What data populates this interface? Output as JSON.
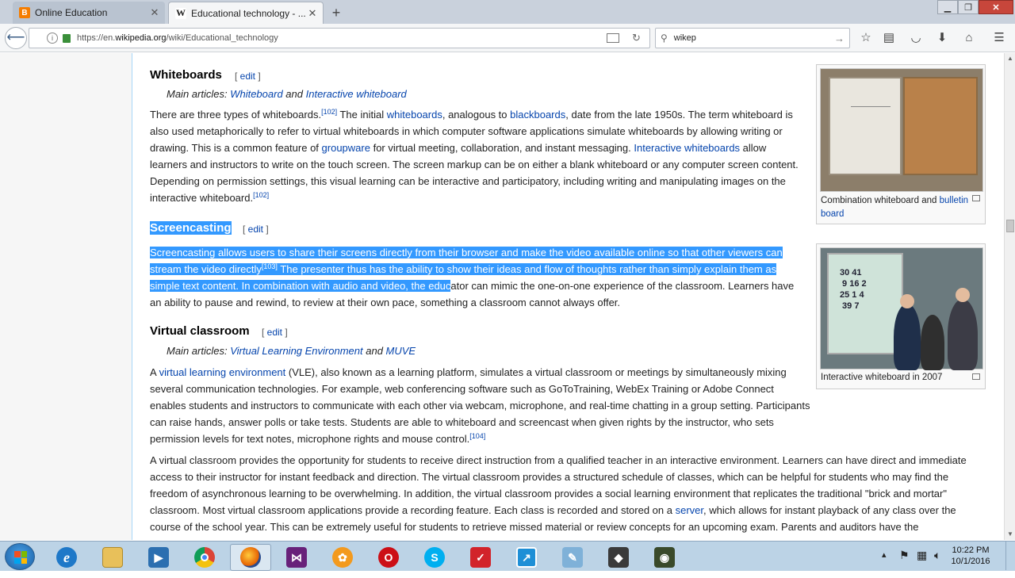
{
  "browser": {
    "tabs": [
      {
        "title": "Online Education",
        "active": false
      },
      {
        "title": "Educational technology - ...",
        "active": true
      }
    ],
    "new_tab": "+",
    "url_prefix": "https://en.",
    "url_domain": "wikipedia.org",
    "url_path": "/wiki/Educational_technology",
    "search_value": "wikep"
  },
  "article": {
    "whiteboards": {
      "heading": "Whiteboards",
      "edit": "edit",
      "main_prefix": "Main articles: ",
      "main_link1": "Whiteboard",
      "main_and": " and ",
      "main_link2": "Interactive whiteboard",
      "p1": [
        "There are three types of whiteboards.",
        "[102]",
        " The initial ",
        "whiteboards",
        ", analogous to ",
        "blackboards",
        ", date from the late 1950s. The term whiteboard is also used metaphorically to refer to virtual whiteboards in which computer software applications simulate whiteboards by allowing writing or drawing. This is a common feature of ",
        "groupware",
        " for virtual meeting, collaboration, and instant messaging. ",
        "Interactive whiteboards",
        " allow learners and instructors to write on the touch screen. The screen markup can be on either a blank whiteboard or any computer screen content. Depending on permission settings, this visual learning can be interactive and participatory, including writing and manipulating images on the interactive whiteboard.",
        "[102]"
      ]
    },
    "screencasting": {
      "heading": "Screencasting",
      "edit": "edit",
      "sel1": "Screencasting allows users to share their screens directly from their browser and make the video available online so that other viewers can stream the video directly",
      "ref": "[103]",
      "sel2": " The presenter thus has the ability to show their ideas and flow of thoughts rather than simply explain them as simple text content. In combination with audio and video, the educ",
      "rest": "ator can mimic the one-on-one experience of the classroom. Learners have an ability to pause and rewind, to review at their own pace, something a classroom cannot always offer."
    },
    "virtual_classroom": {
      "heading": "Virtual classroom",
      "edit": "edit",
      "main_prefix": "Main articles: ",
      "main_link1": "Virtual Learning Environment",
      "main_and": " and ",
      "main_link2": "MUVE",
      "p1": [
        "A ",
        "virtual learning environment",
        " (VLE), also known as a learning platform, simulates a virtual classroom or meetings by simultaneously mixing several communication technologies. For example, web conferencing software such as GoToTraining, WebEx Training or Adobe Connect enables students and instructors to communicate with each other via webcam, microphone, and real-time chatting in a group setting. Participants can raise hands, answer polls or take tests. Students are able to whiteboard and screencast when given rights by the instructor, who sets permission levels for text notes, microphone rights and mouse control.",
        "[104]"
      ],
      "p2": [
        "A virtual classroom provides the opportunity for students to receive direct instruction from a qualified teacher in an interactive environment. Learners can have direct and immediate access to their instructor for instant feedback and direction. The virtual classroom provides a structured schedule of classes, which can be helpful for students who may find the freedom of asynchronous learning to be overwhelming. In addition, the virtual classroom provides a social learning environment that replicates the traditional \"brick and mortar\" classroom. Most virtual classroom applications provide a recording feature. Each class is recorded and stored on a ",
        "server",
        ", which allows for instant playback of any class over the course of the school year. This can be extremely useful for students to retrieve missed material or review concepts for an upcoming exam. Parents and auditors have the"
      ]
    },
    "thumb1": {
      "caption": "Combination whiteboard and ",
      "caption_link": "bulletin board"
    },
    "thumb2": {
      "caption": "Interactive whiteboard in 2007",
      "digits": "30 41\n 9 16 2\n25 1 4\n 39 7"
    }
  },
  "taskbar": {
    "clock_time": "10:22 PM",
    "clock_date": "10/1/2016",
    "apps": [
      "windows-explorer",
      "internet-explorer",
      "file-explorer",
      "media-player",
      "chrome",
      "firefox",
      "visual-studio",
      "app-orange",
      "opera",
      "skype",
      "app-red",
      "app-arrow",
      "app-pen",
      "app-video",
      "app-video-2"
    ]
  },
  "colors": {
    "link": "#0645ad",
    "selection": "#3399ff"
  }
}
